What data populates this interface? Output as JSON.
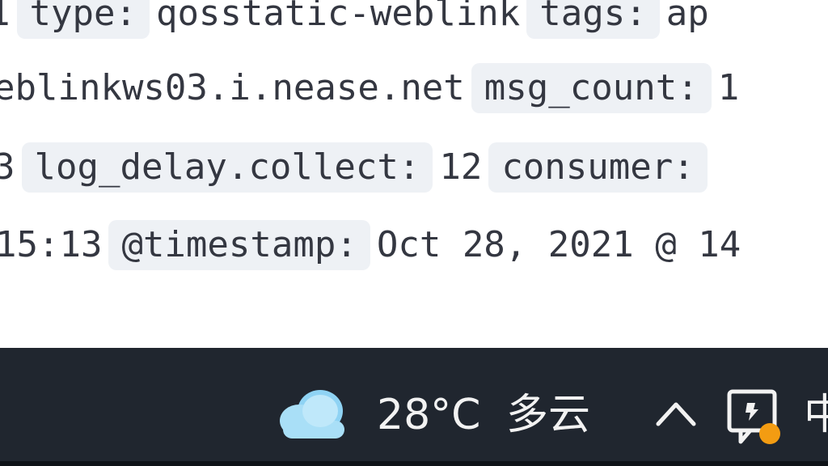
{
  "log_lines": [
    {
      "top": "",
      "segments": [
        {
          "kind": "val",
          "text": "1"
        },
        {
          "kind": "key",
          "text": "type:"
        },
        {
          "kind": "val",
          "text": "qosstatic-weblink"
        },
        {
          "kind": "key",
          "text": "tags:"
        },
        {
          "kind": "val",
          "text": "ap"
        }
      ]
    },
    {
      "segments": [
        {
          "kind": "val",
          "text": "eblinkws03.i.nease.net"
        },
        {
          "kind": "key",
          "text": "msg_count:"
        },
        {
          "kind": "val",
          "text": "1"
        }
      ]
    },
    {
      "segments": [
        {
          "kind": "val",
          "text": "3"
        },
        {
          "kind": "key",
          "text": "log_delay.collect:"
        },
        {
          "kind": "val",
          "text": "12"
        },
        {
          "kind": "key",
          "text": "consumer:"
        }
      ]
    },
    {
      "segments": [
        {
          "kind": "val",
          "text": "15:13"
        },
        {
          "kind": "key",
          "text": "@timestamp:"
        },
        {
          "kind": "val",
          "text": "Oct 28, 2021 @ 14"
        }
      ]
    }
  ],
  "taskbar": {
    "weather_icon": "cloud-icon",
    "temperature": "28°C",
    "condition": "多云",
    "show_hidden_icon": "chevron-up-icon",
    "tray_icon": "feedback-hub-icon",
    "ime_glyph": "中",
    "colors": {
      "background": "#20262f",
      "text": "#f2f2f2",
      "cloud": "#8fd3f4",
      "badge": "#f39c12"
    }
  },
  "colors": {
    "page_background": "#ffffff",
    "field_key_background": "#eef1f5",
    "log_text": "#343741"
  }
}
